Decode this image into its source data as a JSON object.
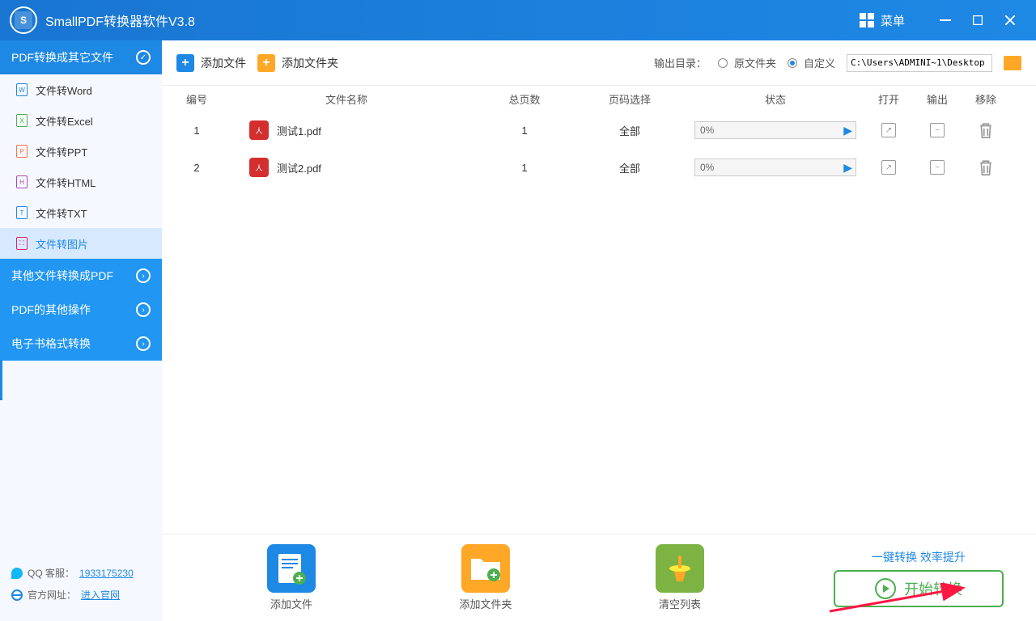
{
  "titlebar": {
    "logo_letter": "S",
    "app_title": "SmallPDF转换器软件V3.8",
    "menu_label": "菜单"
  },
  "sidebar": {
    "cat1_label": "PDF转换成其它文件",
    "items": [
      {
        "label": "文件转Word",
        "icon_color": "#1e88e5"
      },
      {
        "label": "文件转Excel",
        "icon_color": "#4caf50"
      },
      {
        "label": "文件转PPT",
        "icon_color": "#ff7043"
      },
      {
        "label": "文件转HTML",
        "icon_color": "#ab47bc"
      },
      {
        "label": "文件转TXT",
        "icon_color": "#1e88e5"
      },
      {
        "label": "文件转图片",
        "icon_color": "#e91e63"
      }
    ],
    "cat2_label": "其他文件转换成PDF",
    "cat3_label": "PDF的其他操作",
    "cat4_label": "电子书格式转换"
  },
  "footer": {
    "qq_label": "QQ 客服：",
    "qq_number": "1933175230",
    "site_label": "官方网址：",
    "site_link": "进入官网"
  },
  "toolbar": {
    "add_file": "添加文件",
    "add_folder": "添加文件夹",
    "output_label": "输出目录：",
    "radio_original": "原文件夹",
    "radio_custom": "自定义",
    "path_value": "C:\\Users\\ADMINI~1\\Desktop"
  },
  "table": {
    "headers": {
      "num": "编号",
      "name": "文件名称",
      "pages": "总页数",
      "range": "页码选择",
      "status": "状态",
      "open": "打开",
      "output": "输出",
      "remove": "移除"
    },
    "rows": [
      {
        "num": "1",
        "name": "测试1.pdf",
        "pages": "1",
        "range": "全部",
        "progress": "0%"
      },
      {
        "num": "2",
        "name": "测试2.pdf",
        "pages": "1",
        "range": "全部",
        "progress": "0%"
      }
    ]
  },
  "bottom": {
    "add_file": "添加文件",
    "add_folder": "添加文件夹",
    "clear_list": "清空列表",
    "tagline": "一键转换  效率提升",
    "start_label": "开始转换"
  }
}
